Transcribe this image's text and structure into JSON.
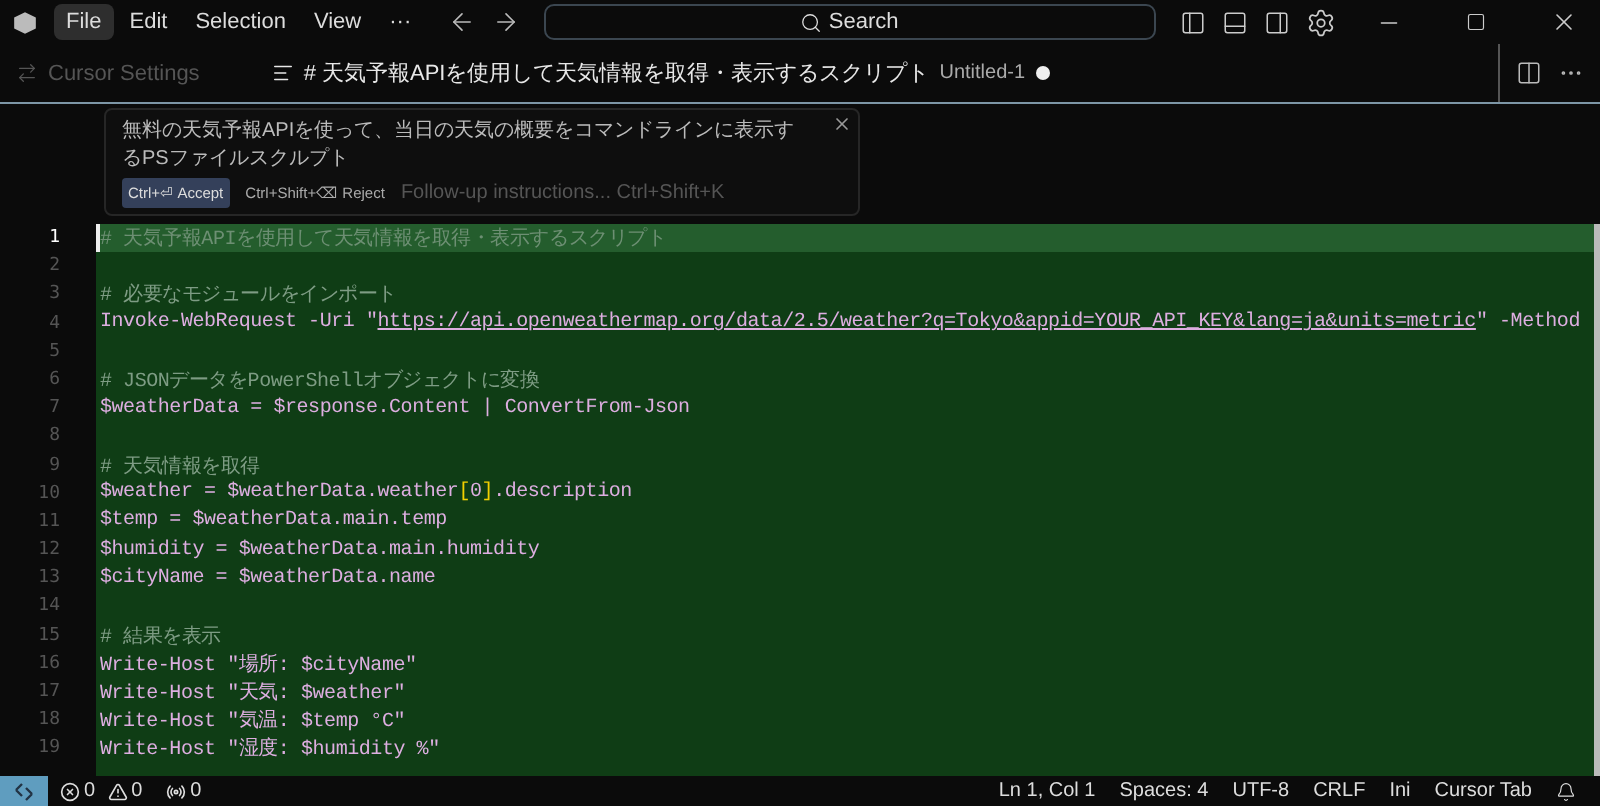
{
  "menu": [
    {
      "label": "File",
      "selected": true
    },
    {
      "label": "Edit",
      "selected": false
    },
    {
      "label": "Selection",
      "selected": false
    },
    {
      "label": "View",
      "selected": false
    },
    {
      "label": "···",
      "selected": false
    }
  ],
  "search": {
    "placeholder": "Search"
  },
  "tabs": [
    {
      "label": "Cursor Settings",
      "selected": false
    },
    {
      "label": "# 天気予報APIを使用して天気情報を取得・表示するスクリプト",
      "description": "Untitled-1",
      "selected": true,
      "dirty": true
    }
  ],
  "prompt": {
    "text": "無料の天気予報APIを使って、当日の天気の概要をコマンドラインに表示するPSファイルスクルプト",
    "accept": "Ctrl+⏎ Accept",
    "reject": "Ctrl+Shift+⌫ Reject",
    "placeholder": "Follow-up instructions... Ctrl+Shift+K"
  },
  "lines": [
    {
      "number": "1",
      "selected": true,
      "tokens": [
        {
          "text": "# 天気予報APIを使用して天気情報を取得・表示するスクリプト",
          "kind": "comment"
        }
      ]
    },
    {
      "number": "2",
      "selected": false
    },
    {
      "number": "3",
      "selected": false,
      "tokens": [
        {
          "text": "# 必要なモジュールをインポート",
          "kind": "comment"
        }
      ]
    },
    {
      "number": "4",
      "selected": false,
      "tokens": [
        {
          "text": "Invoke-WebRequest -Uri \"",
          "kind": "code"
        },
        {
          "text": "https://api.openweathermap.org/data/2.5/weather?q=Tokyo&appid=YOUR_API_KEY&lang=ja&units=metric",
          "kind": "link"
        },
        {
          "text": "\" -Method",
          "kind": "code"
        }
      ]
    },
    {
      "number": "5",
      "selected": false
    },
    {
      "number": "6",
      "selected": false,
      "tokens": [
        {
          "text": "# JSONデータをPowerShellオブジェクトに変換",
          "kind": "comment"
        }
      ]
    },
    {
      "number": "7",
      "selected": false,
      "tokens": [
        {
          "text": "$weatherData = $response.Content | ConvertFrom-Json",
          "kind": "code"
        }
      ]
    },
    {
      "number": "8",
      "selected": false
    },
    {
      "number": "9",
      "selected": false,
      "tokens": [
        {
          "text": "# 天気情報を取得",
          "kind": "comment"
        }
      ]
    },
    {
      "number": "10",
      "selected": false,
      "tokens": [
        {
          "text": "$weather = $weatherData.weather",
          "kind": "code"
        },
        {
          "text": "[",
          "kind": "bracket"
        },
        {
          "text": "0",
          "kind": "code"
        },
        {
          "text": "]",
          "kind": "bracket"
        },
        {
          "text": ".description",
          "kind": "code"
        }
      ]
    },
    {
      "number": "11",
      "selected": false,
      "tokens": [
        {
          "text": "$temp = $weatherData.main.temp",
          "kind": "code"
        }
      ]
    },
    {
      "number": "12",
      "selected": false,
      "tokens": [
        {
          "text": "$humidity = $weatherData.main.humidity",
          "kind": "code"
        }
      ]
    },
    {
      "number": "13",
      "selected": false,
      "tokens": [
        {
          "text": "$cityName = $weatherData.name",
          "kind": "code"
        }
      ]
    },
    {
      "number": "14",
      "selected": false
    },
    {
      "number": "15",
      "selected": false,
      "tokens": [
        {
          "text": "# 結果を表示",
          "kind": "comment"
        }
      ]
    },
    {
      "number": "16",
      "selected": false,
      "tokens": [
        {
          "text": "Write-Host \"場所: $cityName\"",
          "kind": "code"
        }
      ]
    },
    {
      "number": "17",
      "selected": false,
      "tokens": [
        {
          "text": "Write-Host \"天気: $weather\"",
          "kind": "code"
        }
      ]
    },
    {
      "number": "18",
      "selected": false,
      "tokens": [
        {
          "text": "Write-Host \"気温: $temp °C\"",
          "kind": "code"
        }
      ]
    },
    {
      "number": "19",
      "selected": false,
      "tokens": [
        {
          "text": "Write-Host \"湿度: $humidity %\"",
          "kind": "code"
        }
      ]
    }
  ],
  "status_bar": {
    "errors": "0",
    "warnings": "0",
    "ports": "0",
    "items": [
      "Ln 1, Col 1",
      "Spaces: 4",
      "UTF-8",
      "CRLF",
      "Ini",
      "Cursor Tab"
    ]
  }
}
